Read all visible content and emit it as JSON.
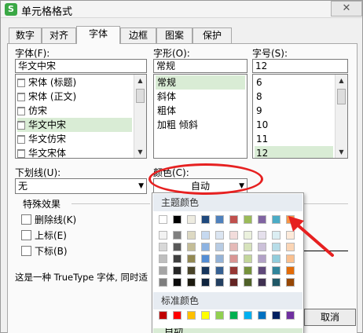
{
  "window": {
    "title": "单元格格式",
    "app_icon_label": "S",
    "close_glyph": "✕"
  },
  "tabs": [
    {
      "label": "数字"
    },
    {
      "label": "对齐"
    },
    {
      "label": "字体"
    },
    {
      "label": "边框"
    },
    {
      "label": "图案"
    },
    {
      "label": "保护"
    }
  ],
  "active_tab": "字体",
  "font": {
    "label": "字体(F):",
    "value": "华文中宋",
    "items": [
      "宋体 (标题)",
      "宋体 (正文)",
      "仿宋",
      "华文中宋",
      "华文仿宋",
      "华文宋体"
    ],
    "selected": "华文中宋"
  },
  "style": {
    "label": "字形(O):",
    "value": "常规",
    "items": [
      "常规",
      "斜体",
      "粗体",
      "加粗 倾斜"
    ],
    "selected": "常规"
  },
  "size": {
    "label": "字号(S):",
    "value": "12",
    "items": [
      "6",
      "8",
      "9",
      "10",
      "11",
      "12"
    ],
    "selected": "12"
  },
  "underline": {
    "label": "下划线(U):",
    "value": "无"
  },
  "color": {
    "label": "颜色(C):",
    "value": "自动"
  },
  "effects": {
    "label": "特殊效果",
    "items": [
      "删除线(K)",
      "上标(E)",
      "下标(B)"
    ]
  },
  "note": "这是一种 TrueType 字体, 同时适",
  "popup": {
    "theme_header": "主题颜色",
    "standard_header": "标准颜色",
    "auto_label": "自动",
    "theme_top": [
      "#ffffff",
      "#000000",
      "#eeece1",
      "#1f497d",
      "#4f81bd",
      "#c0504d",
      "#9bbb59",
      "#8064a2",
      "#4bacc6",
      "#f79646"
    ],
    "theme_shades": [
      [
        "#f2f2f2",
        "#7f7f7f",
        "#ddd9c3",
        "#c6d9f0",
        "#dbe5f1",
        "#f2dcdb",
        "#ebf1dd",
        "#e5e0ec",
        "#dbeef3",
        "#fdeada"
      ],
      [
        "#d8d8d8",
        "#595959",
        "#c4bd97",
        "#8db3e2",
        "#b8cce4",
        "#e5b9b7",
        "#d7e3bc",
        "#ccc1d9",
        "#b7dde8",
        "#fbd5b5"
      ],
      [
        "#bfbfbf",
        "#3f3f3f",
        "#938953",
        "#548dd4",
        "#95b3d7",
        "#d99694",
        "#c3d69b",
        "#b2a2c7",
        "#92cddc",
        "#fac08f"
      ],
      [
        "#a5a5a5",
        "#262626",
        "#494429",
        "#17365d",
        "#366092",
        "#953734",
        "#76923c",
        "#5f497a",
        "#31859b",
        "#e36c09"
      ],
      [
        "#7f7f7f",
        "#0c0c0c",
        "#1d1b10",
        "#0f243e",
        "#244061",
        "#632423",
        "#4f6128",
        "#3f3151",
        "#205867",
        "#974806"
      ]
    ],
    "standard": [
      "#c00000",
      "#ff0000",
      "#ffc000",
      "#ffff00",
      "#92d050",
      "#00b050",
      "#00b0f0",
      "#0070c0",
      "#002060",
      "#7030a0"
    ]
  },
  "buttons": {
    "cancel": "取消"
  },
  "annotation_color": "#e62020"
}
